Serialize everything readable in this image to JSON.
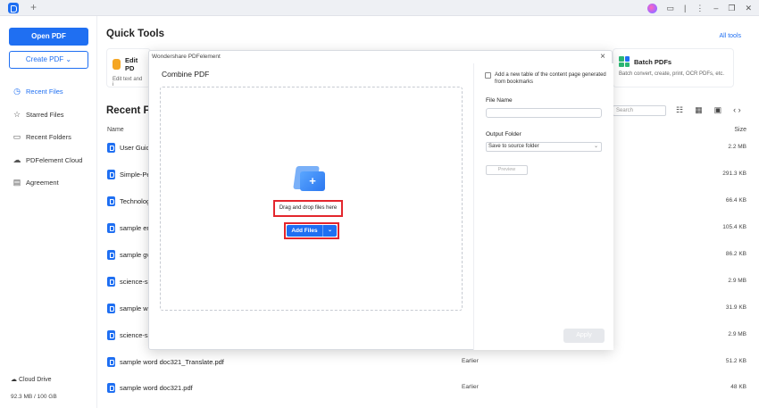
{
  "titlebar": {
    "new_tab": "+",
    "icons": [
      "avatar-icon",
      "chat-icon",
      "separator",
      "more-icon",
      "minimize-icon",
      "restore-icon",
      "close-icon"
    ]
  },
  "sidebar": {
    "open_pdf": "Open PDF",
    "create_pdf": "Create PDF",
    "items": [
      {
        "label": "Recent Files",
        "icon": "clock-icon",
        "active": true
      },
      {
        "label": "Starred Files",
        "icon": "star-icon",
        "active": false
      },
      {
        "label": "Recent Folders",
        "icon": "folder-icon",
        "active": false
      },
      {
        "label": "PDFelement Cloud",
        "icon": "cloud-icon",
        "active": false
      },
      {
        "label": "Agreement",
        "icon": "document-icon",
        "active": false
      }
    ],
    "cloud_drive": "Cloud Drive",
    "storage": "92.3 MB / 100 GB"
  },
  "main": {
    "quick_tools_title": "Quick Tools",
    "all_tools": "All tools",
    "tools": [
      {
        "name": "Edit PD",
        "desc": "Edit text and i"
      },
      {
        "name": "Batch PDFs",
        "desc": "Batch convert, create, print, OCR PDFs, etc."
      }
    ],
    "recent_title": "Recent Fil",
    "search_placeholder": "Search",
    "columns": {
      "name": "Name",
      "size": "Size"
    },
    "files": [
      {
        "name": "User Guid",
        "date": "",
        "size": "2.2 MB"
      },
      {
        "name": "Simple-Pe",
        "date": "",
        "size": "291.3 KB"
      },
      {
        "name": "Technolog",
        "date": "",
        "size": "66.4 KB"
      },
      {
        "name": "sample er",
        "date": "",
        "size": "105.4 KB"
      },
      {
        "name": "sample gv",
        "date": "",
        "size": "86.2 KB"
      },
      {
        "name": "science-si",
        "date": "",
        "size": "2.9 MB"
      },
      {
        "name": "sample w",
        "date": "",
        "size": "31.9 KB"
      },
      {
        "name": "science-si",
        "date": "",
        "size": "2.9 MB"
      },
      {
        "name": "sample word doc321_Translate.pdf",
        "date": "Earlier",
        "size": "51.2 KB"
      },
      {
        "name": "sample word doc321.pdf",
        "date": "Earlier",
        "size": "48 KB"
      }
    ]
  },
  "dialog": {
    "window_title": "Wondershare PDFelement",
    "heading": "Combine PDF",
    "drag_text": "Drag and drop files here",
    "add_files": "Add Files",
    "toc_label": "Add a new table of the content page generated from bookmarks",
    "file_name_label": "File Name",
    "file_name_value": "",
    "output_folder_label": "Output Folder",
    "output_folder_value": "Save to source folder",
    "preview": "Preview",
    "apply": "Apply"
  }
}
